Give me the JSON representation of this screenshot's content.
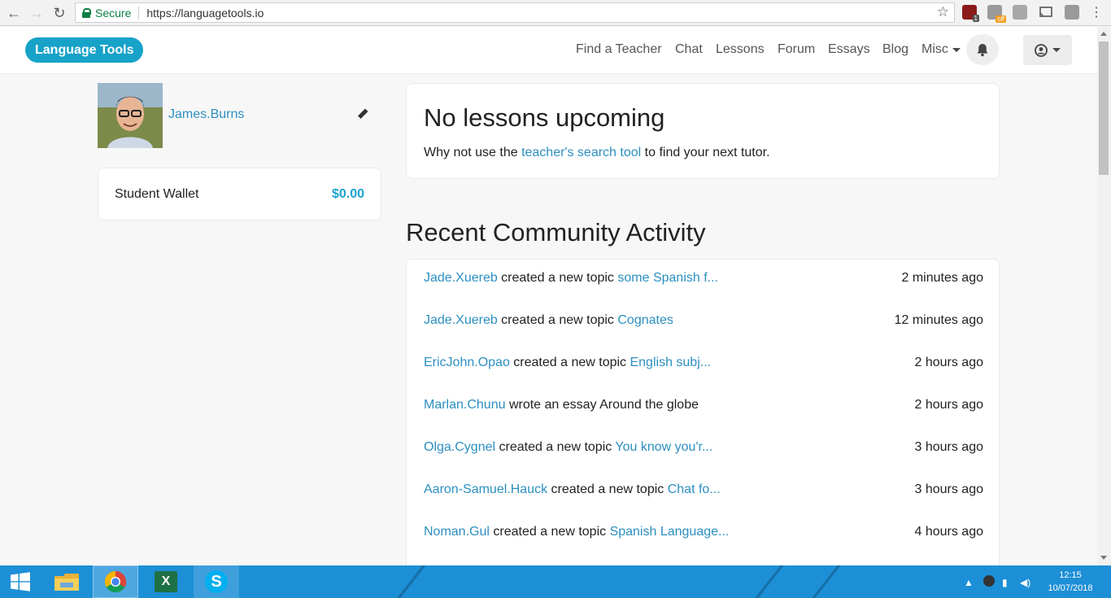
{
  "browser": {
    "secure_label": "Secure",
    "url": "https://languagetools.io",
    "extension_badge_count": "1",
    "extension_off_label": "off"
  },
  "header": {
    "logo": "Language Tools",
    "nav": [
      "Find a Teacher",
      "Chat",
      "Lessons",
      "Forum",
      "Essays",
      "Blog",
      "Misc"
    ]
  },
  "profile": {
    "username": "James.Burns"
  },
  "wallet": {
    "label": "Student Wallet",
    "amount": "$0.00"
  },
  "lessons": {
    "title": "No lessons upcoming",
    "text_before": "Why not use the ",
    "link": "teacher's search tool",
    "text_after": " to find your next tutor."
  },
  "activity": {
    "title": "Recent Community Activity",
    "items": [
      {
        "user": "Jade.Xuereb",
        "action": " created a new topic ",
        "target": "some Spanish f...",
        "target_link": true,
        "when": "2 minutes ago"
      },
      {
        "user": "Jade.Xuereb",
        "action": " created a new topic ",
        "target": "Cognates",
        "target_link": true,
        "when": "12 minutes ago"
      },
      {
        "user": "EricJohn.Opao",
        "action": " created a new topic ",
        "target": "English subj...",
        "target_link": true,
        "when": "2 hours ago"
      },
      {
        "user": "Marlan.Chunu",
        "action": " wrote an essay ",
        "target": "Around the globe",
        "target_link": false,
        "when": "2 hours ago"
      },
      {
        "user": "Olga.Cygnel",
        "action": " created a new topic ",
        "target": "You know you'r...",
        "target_link": true,
        "when": "3 hours ago"
      },
      {
        "user": "Aaron-Samuel.Hauck",
        "action": " created a new topic ",
        "target": "Chat fo...",
        "target_link": true,
        "when": "3 hours ago"
      },
      {
        "user": "Noman.Gul",
        "action": " created a new topic ",
        "target": "Spanish Language...",
        "target_link": true,
        "when": "4 hours ago"
      }
    ]
  },
  "taskbar": {
    "skype_letter": "S",
    "excel_letter": "X",
    "time": "12:15",
    "date": "10/07/2018"
  },
  "colors": {
    "brand": "#17a2c8",
    "link": "#2c8fc0",
    "wallet_amount": "#1aa3d0",
    "taskbar": "#1d8fd6"
  }
}
